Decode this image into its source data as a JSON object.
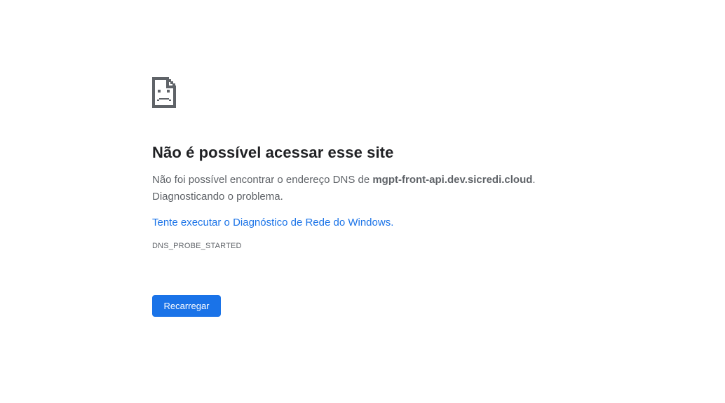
{
  "error": {
    "icon": "sad-page-icon",
    "title": "Não é possível acessar esse site",
    "desc_prefix": "Não foi possível encontrar o endereço DNS de ",
    "host": "mgpt-front-api.dev.sicredi.cloud",
    "desc_suffix": ".",
    "desc_line2": "Diagnosticando o problema.",
    "diag_link": "Tente executar o Diagnóstico de Rede do Windows.",
    "code": "DNS_PROBE_STARTED"
  },
  "actions": {
    "reload_label": "Recarregar"
  },
  "colors": {
    "accent": "#1a73e8",
    "text_primary": "#202124",
    "text_secondary": "#5f6368",
    "background": "#ffffff"
  }
}
